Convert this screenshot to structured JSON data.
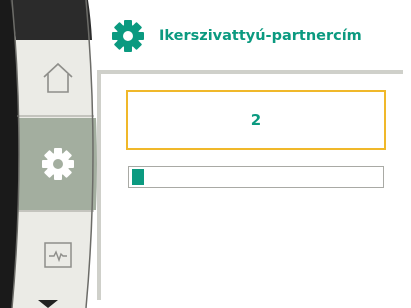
{
  "header": {
    "title": "Ikerszivattyú-partnercím",
    "icon": "settings-gear-icon"
  },
  "menu": {
    "items": [
      {
        "name": "home",
        "icon": "home-icon",
        "active": false
      },
      {
        "name": "settings",
        "icon": "gear-icon",
        "active": true
      },
      {
        "name": "diagnostics",
        "icon": "diagnostics-icon",
        "active": false
      }
    ]
  },
  "editor": {
    "value": "2",
    "progress_fraction": 0.05
  },
  "colors": {
    "accent": "#0b9a80",
    "selection_border": "#f0b82a",
    "menu_background": "#ebebe6",
    "menu_active": "#a3ae9f",
    "panel_border": "#cfd0ca"
  }
}
